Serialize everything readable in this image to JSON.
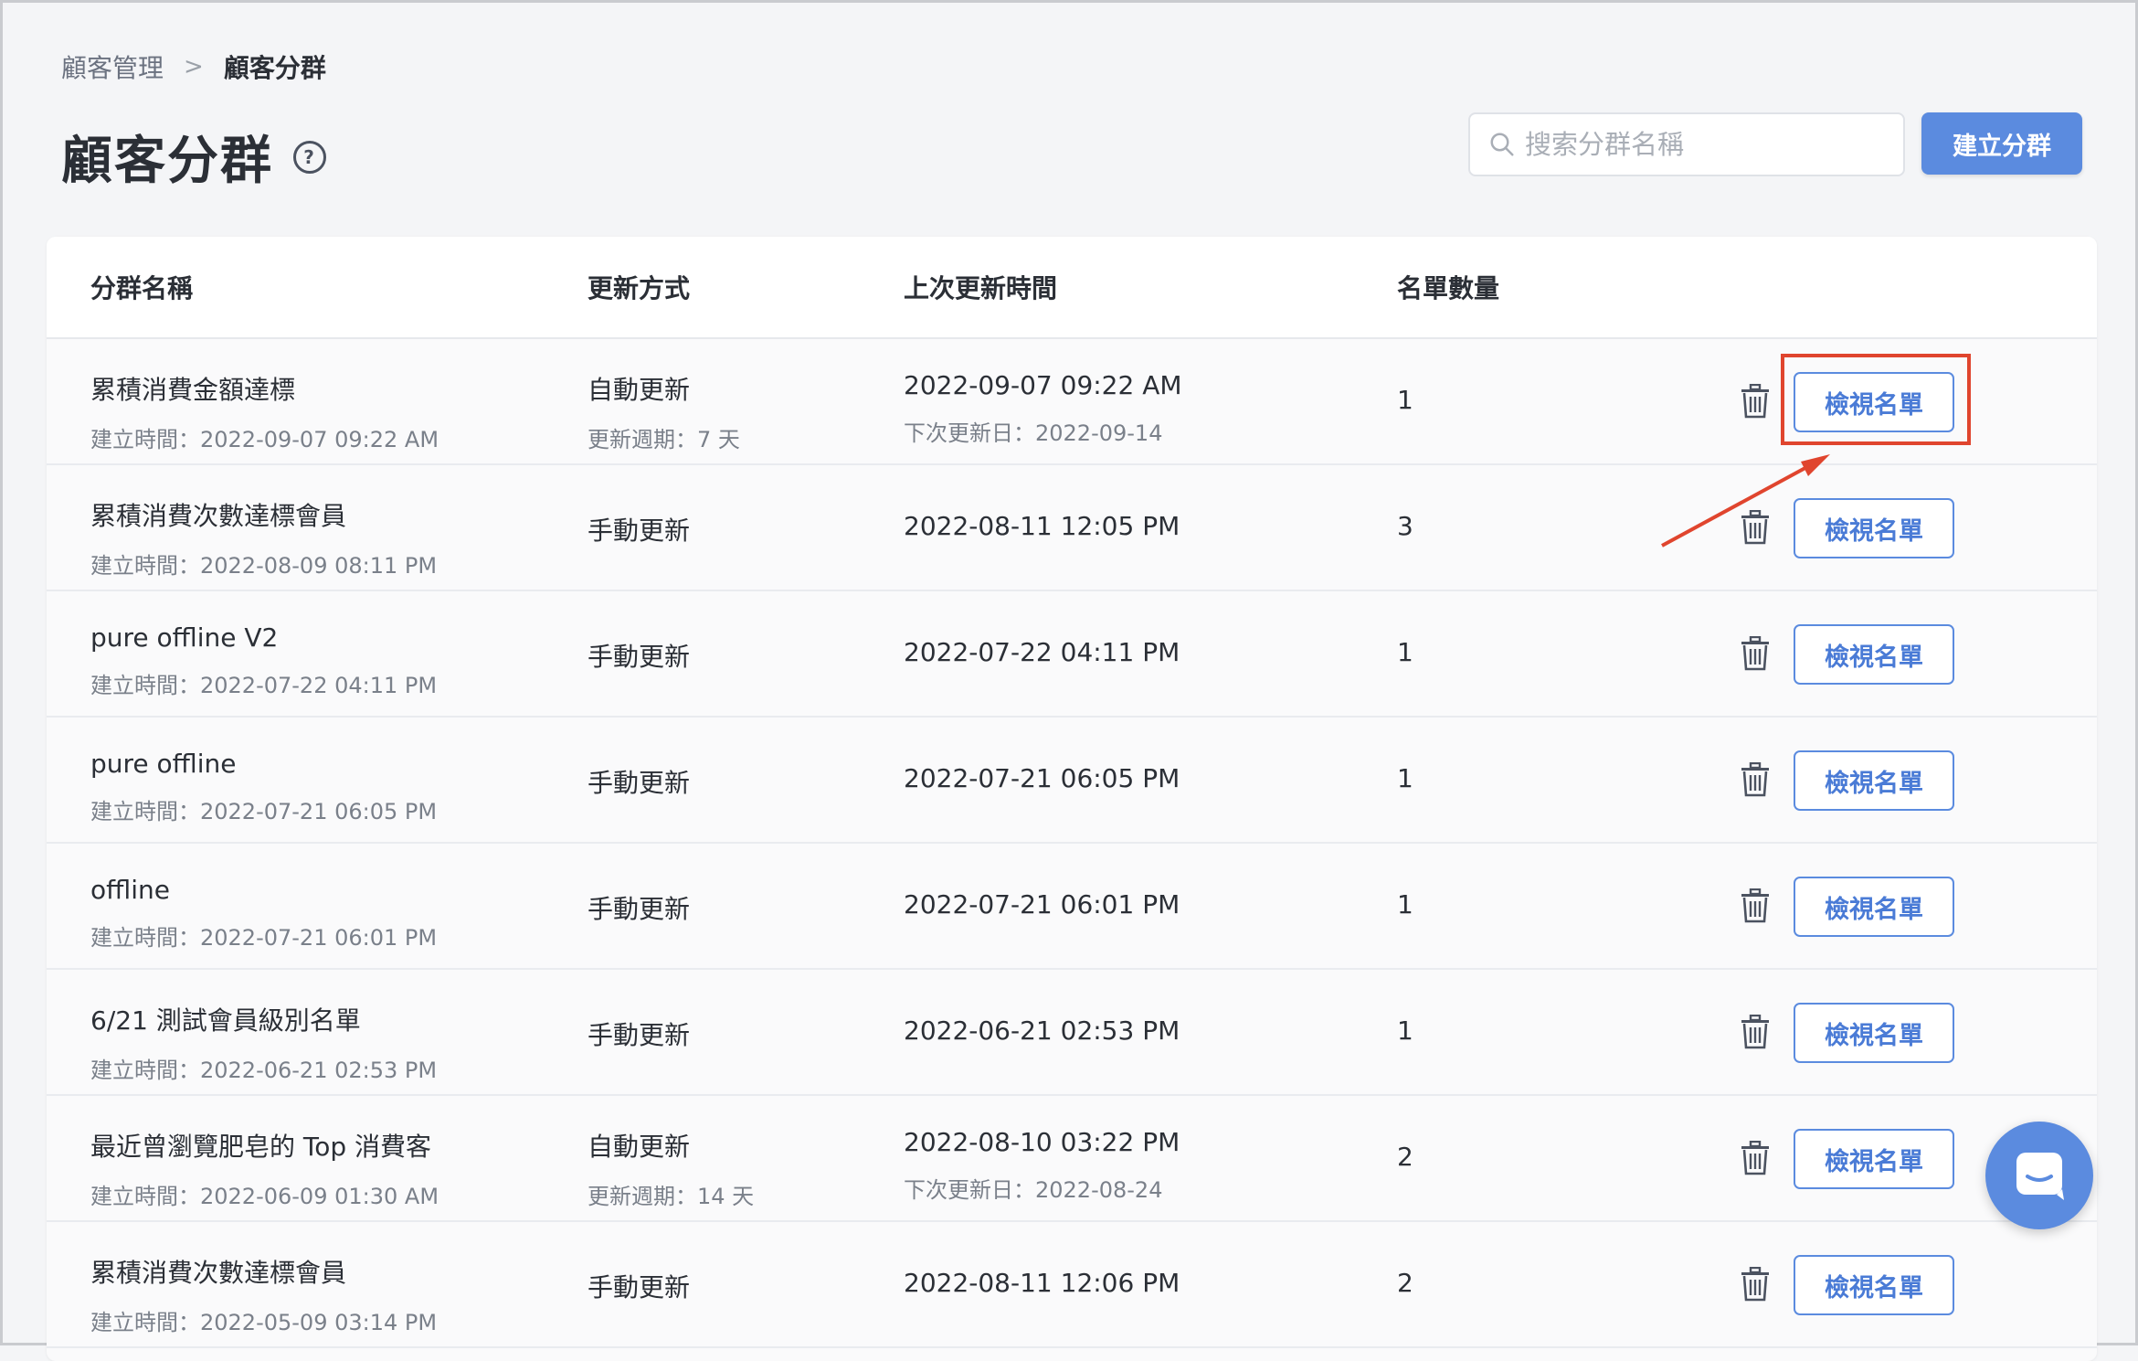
{
  "breadcrumb": {
    "parent": "顧客管理",
    "separator": ">",
    "current": "顧客分群"
  },
  "page": {
    "title": "顧客分群",
    "help_icon": "?"
  },
  "search": {
    "placeholder": "搜索分群名稱",
    "value": ""
  },
  "toolbar": {
    "create_label": "建立分群"
  },
  "table": {
    "headers": {
      "name": "分群名稱",
      "update_method": "更新方式",
      "last_updated": "上次更新時間",
      "count": "名單數量"
    },
    "rows": [
      {
        "name": "累積消費金額達標",
        "created": "建立時間：2022-09-07 09:22 AM",
        "method": "自動更新",
        "method_sub": "更新週期：7 天",
        "updated": "2022-09-07 09:22 AM",
        "updated_sub": "下次更新日：2022-09-14",
        "count": "1",
        "view_label": "檢視名單"
      },
      {
        "name": "累積消費次數達標會員",
        "created": "建立時間：2022-08-09 08:11 PM",
        "method": "手動更新",
        "method_sub": "",
        "updated": "2022-08-11 12:05 PM",
        "updated_sub": "",
        "count": "3",
        "view_label": "檢視名單"
      },
      {
        "name": "pure offline V2",
        "created": "建立時間：2022-07-22 04:11 PM",
        "method": "手動更新",
        "method_sub": "",
        "updated": "2022-07-22 04:11 PM",
        "updated_sub": "",
        "count": "1",
        "view_label": "檢視名單"
      },
      {
        "name": "pure offline",
        "created": "建立時間：2022-07-21 06:05 PM",
        "method": "手動更新",
        "method_sub": "",
        "updated": "2022-07-21 06:05 PM",
        "updated_sub": "",
        "count": "1",
        "view_label": "檢視名單"
      },
      {
        "name": "offline",
        "created": "建立時間：2022-07-21 06:01 PM",
        "method": "手動更新",
        "method_sub": "",
        "updated": "2022-07-21 06:01 PM",
        "updated_sub": "",
        "count": "1",
        "view_label": "檢視名單"
      },
      {
        "name": "6/21 測試會員級別名單",
        "created": "建立時間：2022-06-21 02:53 PM",
        "method": "手動更新",
        "method_sub": "",
        "updated": "2022-06-21 02:53 PM",
        "updated_sub": "",
        "count": "1",
        "view_label": "檢視名單"
      },
      {
        "name": "最近曾瀏覽肥皂的 Top 消費客",
        "created": "建立時間：2022-06-09 01:30 AM",
        "method": "自動更新",
        "method_sub": "更新週期：14 天",
        "updated": "2022-08-10 03:22 PM",
        "updated_sub": "下次更新日：2022-08-24",
        "count": "2",
        "view_label": "檢視名單"
      },
      {
        "name": "累積消費次數達標會員",
        "created": "建立時間：2022-05-09 03:14 PM",
        "method": "手動更新",
        "method_sub": "",
        "updated": "2022-08-11 12:06 PM",
        "updated_sub": "",
        "count": "2",
        "view_label": "檢視名單"
      }
    ]
  },
  "icons": {
    "search": "search-icon",
    "trash": "trash-icon",
    "chat": "chat-icon"
  },
  "colors": {
    "accent": "#5b8bdf",
    "annotation": "#e0452e"
  }
}
